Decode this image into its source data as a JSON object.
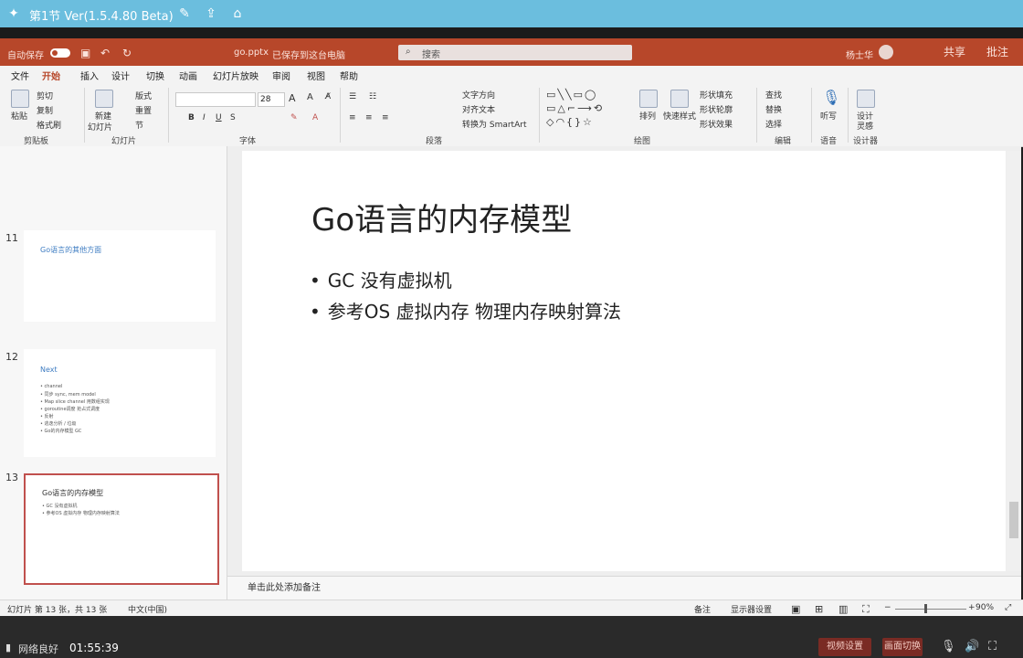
{
  "player": {
    "title": "第1节 Ver(1.5.4.80 Beta)"
  },
  "ppt": {
    "autosave": "自动保存",
    "filename": "go.pptx",
    "saved": "已保存到这台电脑",
    "search_placeholder": "搜索",
    "user": "杨士华",
    "share": "共享",
    "comments": "批注"
  },
  "menu_tabs": [
    "文件",
    "开始",
    "插入",
    "设计",
    "切换",
    "动画",
    "幻灯片放映",
    "审阅",
    "视图",
    "帮助"
  ],
  "ribbon": {
    "paste": "粘贴",
    "cut": "剪切",
    "copy": "复制",
    "format_painter": "格式刷",
    "new_slide": "新建",
    "new_slide2": "幻灯片",
    "layout": "版式",
    "reset": "重置",
    "section": "节",
    "font_size": "28",
    "text_direction": "文字方向",
    "align_text": "对齐文本",
    "smartart": "转换为 SmartArt",
    "arrange": "排列",
    "quick_styles": "快速样式",
    "shape_fill": "形状填充",
    "shape_outline": "形状轮廓",
    "shape_effects": "形状效果",
    "find": "查找",
    "replace": "替换",
    "select": "选择",
    "dictate": "听写",
    "designer": "设计",
    "designer2": "灵感",
    "groups": {
      "clipboard": "剪贴板",
      "slides": "幻灯片",
      "font": "字体",
      "paragraph": "段落",
      "drawing": "绘图",
      "editing": "编辑",
      "voice": "语音",
      "designer": "设计器"
    }
  },
  "thumbnails": [
    {
      "num": "11",
      "title": "Go语言的其他方面",
      "lines": []
    },
    {
      "num": "12",
      "title": "Next",
      "lines": [
        "• channel",
        "• 同步 sync, mem model",
        "• Map slice channel 用数组实现",
        "• goroutine调度 抢占式调度",
        "• 反射",
        "• 逃逸分析 / 垃圾",
        "• Go的内存模型 GC"
      ]
    },
    {
      "num": "13",
      "title": "Go语言的内存模型",
      "lines": [
        "• GC 没有虚拟机",
        "• 参考OS 虚拟内存 物理内存映射算法"
      ]
    }
  ],
  "slide": {
    "title": "Go语言的内存模型",
    "bullets": [
      "GC 没有虚拟机",
      "参考OS 虚拟内存 物理内存映射算法"
    ]
  },
  "notes_placeholder": "单击此处添加备注",
  "status": {
    "slide_count": "幻灯片 第 13 张，共 13 张",
    "language": "中文(中国)",
    "notes": "备注",
    "display_settings": "显示器设置",
    "zoom": "90%"
  },
  "bottom": {
    "network": "网络良好",
    "time": "01:55:39",
    "btn1": "视频设置",
    "btn2": "画面切换"
  }
}
